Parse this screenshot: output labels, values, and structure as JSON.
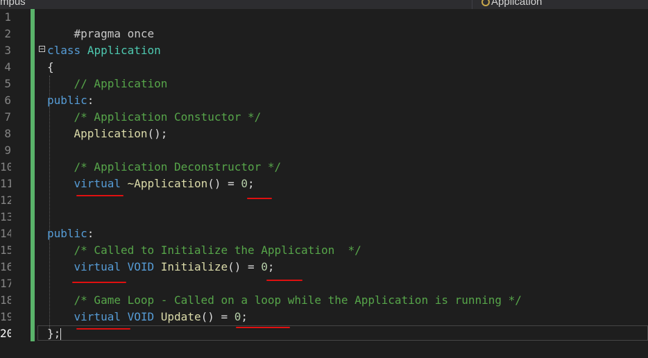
{
  "tabs": {
    "left_label": "mpus",
    "right_label": "Application"
  },
  "gutter": {
    "line_numbers": [
      "1",
      "2",
      "3",
      "4",
      "5",
      "6",
      "7",
      "8",
      "9",
      "10",
      "11",
      "12",
      "13",
      "14",
      "15",
      "16",
      "17",
      "18",
      "19",
      "20"
    ],
    "current_line": "20"
  },
  "code": {
    "l1": {
      "pp": "#pragma once"
    },
    "l3": {
      "kw": "class",
      "name": "Application"
    },
    "l4": {
      "brace": "{"
    },
    "l5": {
      "comment": "// Application"
    },
    "l6": {
      "kw": "public",
      "colon": ":"
    },
    "l7": {
      "comment": "/* Application Constuctor */"
    },
    "l8": {
      "fn": "Application",
      "rest": "();"
    },
    "l10": {
      "comment": "/* Application Deconstructor */"
    },
    "l11": {
      "kw": "virtual",
      "fn": "~Application",
      "mid": "() = ",
      "num": "0",
      "end": ";"
    },
    "l14": {
      "kw": "public",
      "colon": ":"
    },
    "l15": {
      "comment": "/* Called to Initialize the Application  */"
    },
    "l16": {
      "kw": "virtual",
      "type": "VOID",
      "fn": "Initialize",
      "mid": "() = ",
      "num": "0",
      "end": ";"
    },
    "l18": {
      "comment": "/* Game Loop - Called on a loop while the Application is running */"
    },
    "l19": {
      "kw": "virtual",
      "type": "VOID",
      "fn": "Update",
      "mid": "() = ",
      "num": "0",
      "end": ";"
    },
    "l20": {
      "brace": "};"
    }
  },
  "colors": {
    "background": "#1e1e1e",
    "keyword": "#569cd6",
    "class_name": "#4ec9b0",
    "comment": "#57a64a",
    "change_bar": "#5ab36a",
    "annotation_underline": "#e01010"
  }
}
